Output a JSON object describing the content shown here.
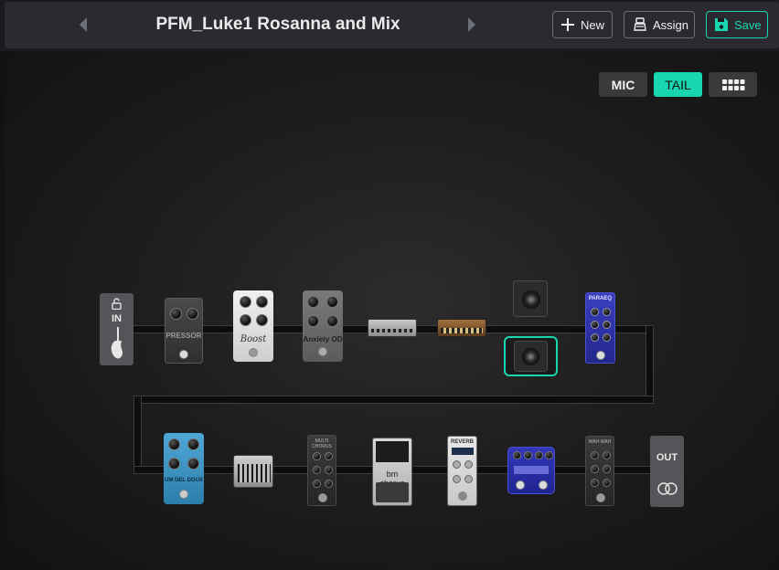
{
  "header": {
    "preset_name": "PFM_Luke1 Rosanna and Mix",
    "new_label": "New",
    "assign_label": "Assign",
    "save_label": "Save"
  },
  "view_toggle": {
    "mic_label": "MIC",
    "tail_label": "TAIL",
    "active": "TAIL",
    "grid_icon": "grid-icon"
  },
  "colors": {
    "accent": "#18d6b0",
    "header_bg": "#2a2a30",
    "toggle_bg": "#3a3a3d"
  },
  "chain": {
    "input_label": "IN",
    "output_label": "OUT",
    "row1_blocks": [
      "compressor-pedal",
      "boost-pedal",
      "overdrive-pedal",
      "amp-head-silver",
      "amp-head-wood",
      "cabinet-top",
      "cabinet-selected",
      "parametric-eq-pedal"
    ],
    "row2_blocks": [
      "delay-pedal",
      "graphic-eq",
      "multi-chorus-pedal",
      "chorus-pedal",
      "reverb-pedal",
      "modulation-pedal",
      "wah-pedal"
    ],
    "pedal_text": {
      "compressor": "PRESSOR",
      "boost": "Boost",
      "overdrive": "Anxiety OD",
      "delay": "UM DEL DOUX",
      "multi_chorus": "MULTI CHORUS",
      "chorus": "bm chorus",
      "reverb": "REVERB",
      "wah": "WAH-WAH",
      "parametric": "PARAEQ"
    },
    "selected_block": "cabinet-selected"
  }
}
